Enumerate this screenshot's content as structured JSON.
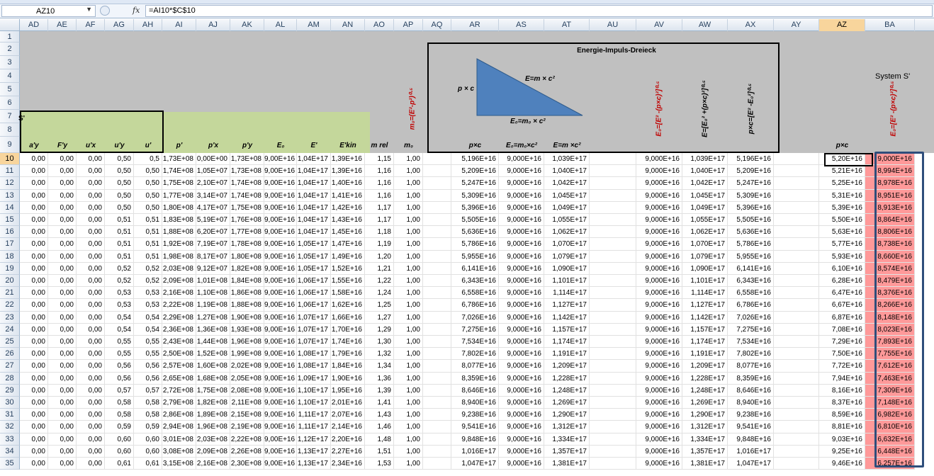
{
  "name_box": "AZ10",
  "fx_label": "fx",
  "formula": "=AI10*$C$10",
  "columns": [
    "AD",
    "AE",
    "AF",
    "AG",
    "AH",
    "AI",
    "AJ",
    "AK",
    "AL",
    "AM",
    "AN",
    "AO",
    "AP",
    "AQ",
    "AR",
    "AS",
    "AT",
    "AU",
    "AV",
    "AW",
    "AX",
    "AY",
    "AZ",
    "BA"
  ],
  "active_column": "AZ",
  "header_rows": [
    "1",
    "2",
    "3",
    "4",
    "5",
    "6",
    "7",
    "8",
    "9"
  ],
  "labels": {
    "s_prime": "S'",
    "diagram_title": "Energie-Impuls-Dreieck",
    "system_s_prime": "System S'",
    "tri_pc": "p × c",
    "tri_emc2": "E=m × c²",
    "tri_e0": "E₀=m₀ × c²",
    "rot_m0": "m₀=(E²-p²)⁰·⁵",
    "rot_e0_av": "E₀=[E² -(p×c)²]⁰·⁵",
    "rot_e_aw": "E=[E₀² +(p×c)²]⁰·⁵",
    "rot_pc_ax": "p×c=[E² -E₀²]⁰·⁵",
    "rot_e0_ba": "E₀=[E² -(p×c)²]⁰·⁵",
    "h_ad": "a'y",
    "h_ae": "F'y",
    "h_af": "u'x",
    "h_ag": "u'y",
    "h_ah": "u'",
    "h_ai": "p'",
    "h_aj": "p'x",
    "h_ak": "p'y",
    "h_al": "E₀",
    "h_am": "E'",
    "h_an": "E'kin",
    "h_ao": "m rel",
    "h_ap": "m₀",
    "h_ar": "p×c",
    "h_as": "E₀=m₀×c²",
    "h_at": "E=m ×c²",
    "h_az": "p×c"
  },
  "rows": [
    {
      "r": "10",
      "v": [
        "0,00",
        "0,00",
        "0,00",
        "0,50",
        "0,5",
        "1,73E+08",
        "0,00E+00",
        "1,73E+08",
        "9,00E+16",
        "1,04E+17",
        "1,39E+16",
        "1,15",
        "1,00",
        "",
        "5,196E+16",
        "9,000E+16",
        "1,039E+17",
        "",
        "9,000E+16",
        "1,039E+17",
        "5,196E+16",
        "",
        "5,20E+16",
        "9,000E+16"
      ]
    },
    {
      "r": "11",
      "v": [
        "0,00",
        "0,00",
        "0,00",
        "0,50",
        "0,50",
        "1,74E+08",
        "1,05E+07",
        "1,73E+08",
        "9,00E+16",
        "1,04E+17",
        "1,39E+16",
        "1,16",
        "1,00",
        "",
        "5,209E+16",
        "9,000E+16",
        "1,040E+17",
        "",
        "9,000E+16",
        "1,040E+17",
        "5,209E+16",
        "",
        "5,21E+16",
        "8,994E+16"
      ]
    },
    {
      "r": "12",
      "v": [
        "0,00",
        "0,00",
        "0,00",
        "0,50",
        "0,50",
        "1,75E+08",
        "2,10E+07",
        "1,74E+08",
        "9,00E+16",
        "1,04E+17",
        "1,40E+16",
        "1,16",
        "1,00",
        "",
        "5,247E+16",
        "9,000E+16",
        "1,042E+17",
        "",
        "9,000E+16",
        "1,042E+17",
        "5,247E+16",
        "",
        "5,25E+16",
        "8,978E+16"
      ]
    },
    {
      "r": "13",
      "v": [
        "0,00",
        "0,00",
        "0,00",
        "0,50",
        "0,50",
        "1,77E+08",
        "3,14E+07",
        "1,74E+08",
        "9,00E+16",
        "1,04E+17",
        "1,41E+16",
        "1,16",
        "1,00",
        "",
        "5,309E+16",
        "9,000E+16",
        "1,045E+17",
        "",
        "9,000E+16",
        "1,045E+17",
        "5,309E+16",
        "",
        "5,31E+16",
        "8,951E+16"
      ]
    },
    {
      "r": "14",
      "v": [
        "0,00",
        "0,00",
        "0,00",
        "0,50",
        "0,50",
        "1,80E+08",
        "4,17E+07",
        "1,75E+08",
        "9,00E+16",
        "1,04E+17",
        "1,42E+16",
        "1,17",
        "1,00",
        "",
        "5,396E+16",
        "9,000E+16",
        "1,049E+17",
        "",
        "9,000E+16",
        "1,049E+17",
        "5,396E+16",
        "",
        "5,39E+16",
        "8,913E+16"
      ]
    },
    {
      "r": "15",
      "v": [
        "0,00",
        "0,00",
        "0,00",
        "0,51",
        "0,51",
        "1,83E+08",
        "5,19E+07",
        "1,76E+08",
        "9,00E+16",
        "1,04E+17",
        "1,43E+16",
        "1,17",
        "1,00",
        "",
        "5,505E+16",
        "9,000E+16",
        "1,055E+17",
        "",
        "9,000E+16",
        "1,055E+17",
        "5,505E+16",
        "",
        "5,50E+16",
        "8,864E+16"
      ]
    },
    {
      "r": "16",
      "v": [
        "0,00",
        "0,00",
        "0,00",
        "0,51",
        "0,51",
        "1,88E+08",
        "6,20E+07",
        "1,77E+08",
        "9,00E+16",
        "1,04E+17",
        "1,45E+16",
        "1,18",
        "1,00",
        "",
        "5,636E+16",
        "9,000E+16",
        "1,062E+17",
        "",
        "9,000E+16",
        "1,062E+17",
        "5,636E+16",
        "",
        "5,63E+16",
        "8,806E+16"
      ]
    },
    {
      "r": "17",
      "v": [
        "0,00",
        "0,00",
        "0,00",
        "0,51",
        "0,51",
        "1,92E+08",
        "7,19E+07",
        "1,78E+08",
        "9,00E+16",
        "1,05E+17",
        "1,47E+16",
        "1,19",
        "1,00",
        "",
        "5,786E+16",
        "9,000E+16",
        "1,070E+17",
        "",
        "9,000E+16",
        "1,070E+17",
        "5,786E+16",
        "",
        "5,77E+16",
        "8,738E+16"
      ]
    },
    {
      "r": "18",
      "v": [
        "0,00",
        "0,00",
        "0,00",
        "0,51",
        "0,51",
        "1,98E+08",
        "8,17E+07",
        "1,80E+08",
        "9,00E+16",
        "1,05E+17",
        "1,49E+16",
        "1,20",
        "1,00",
        "",
        "5,955E+16",
        "9,000E+16",
        "1,079E+17",
        "",
        "9,000E+16",
        "1,079E+17",
        "5,955E+16",
        "",
        "5,93E+16",
        "8,660E+16"
      ]
    },
    {
      "r": "19",
      "v": [
        "0,00",
        "0,00",
        "0,00",
        "0,52",
        "0,52",
        "2,03E+08",
        "9,12E+07",
        "1,82E+08",
        "9,00E+16",
        "1,05E+17",
        "1,52E+16",
        "1,21",
        "1,00",
        "",
        "6,141E+16",
        "9,000E+16",
        "1,090E+17",
        "",
        "9,000E+16",
        "1,090E+17",
        "6,141E+16",
        "",
        "6,10E+16",
        "8,574E+16"
      ]
    },
    {
      "r": "20",
      "v": [
        "0,00",
        "0,00",
        "0,00",
        "0,52",
        "0,52",
        "2,09E+08",
        "1,01E+08",
        "1,84E+08",
        "9,00E+16",
        "1,06E+17",
        "1,55E+16",
        "1,22",
        "1,00",
        "",
        "6,343E+16",
        "9,000E+16",
        "1,101E+17",
        "",
        "9,000E+16",
        "1,101E+17",
        "6,343E+16",
        "",
        "6,28E+16",
        "8,479E+16"
      ]
    },
    {
      "r": "21",
      "v": [
        "0,00",
        "0,00",
        "0,00",
        "0,53",
        "0,53",
        "2,16E+08",
        "1,10E+08",
        "1,86E+08",
        "9,00E+16",
        "1,06E+17",
        "1,58E+16",
        "1,24",
        "1,00",
        "",
        "6,558E+16",
        "9,000E+16",
        "1,114E+17",
        "",
        "9,000E+16",
        "1,114E+17",
        "6,558E+16",
        "",
        "6,47E+16",
        "8,376E+16"
      ]
    },
    {
      "r": "22",
      "v": [
        "0,00",
        "0,00",
        "0,00",
        "0,53",
        "0,53",
        "2,22E+08",
        "1,19E+08",
        "1,88E+08",
        "9,00E+16",
        "1,06E+17",
        "1,62E+16",
        "1,25",
        "1,00",
        "",
        "6,786E+16",
        "9,000E+16",
        "1,127E+17",
        "",
        "9,000E+16",
        "1,127E+17",
        "6,786E+16",
        "",
        "6,67E+16",
        "8,266E+16"
      ]
    },
    {
      "r": "23",
      "v": [
        "0,00",
        "0,00",
        "0,00",
        "0,54",
        "0,54",
        "2,29E+08",
        "1,27E+08",
        "1,90E+08",
        "9,00E+16",
        "1,07E+17",
        "1,66E+16",
        "1,27",
        "1,00",
        "",
        "7,026E+16",
        "9,000E+16",
        "1,142E+17",
        "",
        "9,000E+16",
        "1,142E+17",
        "7,026E+16",
        "",
        "6,87E+16",
        "8,148E+16"
      ]
    },
    {
      "r": "24",
      "v": [
        "0,00",
        "0,00",
        "0,00",
        "0,54",
        "0,54",
        "2,36E+08",
        "1,36E+08",
        "1,93E+08",
        "9,00E+16",
        "1,07E+17",
        "1,70E+16",
        "1,29",
        "1,00",
        "",
        "7,275E+16",
        "9,000E+16",
        "1,157E+17",
        "",
        "9,000E+16",
        "1,157E+17",
        "7,275E+16",
        "",
        "7,08E+16",
        "8,023E+16"
      ]
    },
    {
      "r": "25",
      "v": [
        "0,00",
        "0,00",
        "0,00",
        "0,55",
        "0,55",
        "2,43E+08",
        "1,44E+08",
        "1,96E+08",
        "9,00E+16",
        "1,07E+17",
        "1,74E+16",
        "1,30",
        "1,00",
        "",
        "7,534E+16",
        "9,000E+16",
        "1,174E+17",
        "",
        "9,000E+16",
        "1,174E+17",
        "7,534E+16",
        "",
        "7,29E+16",
        "7,893E+16"
      ]
    },
    {
      "r": "26",
      "v": [
        "0,00",
        "0,00",
        "0,00",
        "0,55",
        "0,55",
        "2,50E+08",
        "1,52E+08",
        "1,99E+08",
        "9,00E+16",
        "1,08E+17",
        "1,79E+16",
        "1,32",
        "1,00",
        "",
        "7,802E+16",
        "9,000E+16",
        "1,191E+17",
        "",
        "9,000E+16",
        "1,191E+17",
        "7,802E+16",
        "",
        "7,50E+16",
        "7,755E+16"
      ]
    },
    {
      "r": "27",
      "v": [
        "0,00",
        "0,00",
        "0,00",
        "0,56",
        "0,56",
        "2,57E+08",
        "1,60E+08",
        "2,02E+08",
        "9,00E+16",
        "1,08E+17",
        "1,84E+16",
        "1,34",
        "1,00",
        "",
        "8,077E+16",
        "9,000E+16",
        "1,209E+17",
        "",
        "9,000E+16",
        "1,209E+17",
        "8,077E+16",
        "",
        "7,72E+16",
        "7,612E+16"
      ]
    },
    {
      "r": "28",
      "v": [
        "0,00",
        "0,00",
        "0,00",
        "0,56",
        "0,56",
        "2,65E+08",
        "1,68E+08",
        "2,05E+08",
        "9,00E+16",
        "1,09E+17",
        "1,90E+16",
        "1,36",
        "1,00",
        "",
        "8,359E+16",
        "9,000E+16",
        "1,228E+17",
        "",
        "9,000E+16",
        "1,228E+17",
        "8,359E+16",
        "",
        "7,94E+16",
        "7,463E+16"
      ]
    },
    {
      "r": "29",
      "v": [
        "0,00",
        "0,00",
        "0,00",
        "0,57",
        "0,57",
        "2,72E+08",
        "1,75E+08",
        "2,08E+08",
        "9,00E+16",
        "1,10E+17",
        "1,95E+16",
        "1,39",
        "1,00",
        "",
        "8,646E+16",
        "9,000E+16",
        "1,248E+17",
        "",
        "9,000E+16",
        "1,248E+17",
        "8,646E+16",
        "",
        "8,16E+16",
        "7,309E+16"
      ]
    },
    {
      "r": "30",
      "v": [
        "0,00",
        "0,00",
        "0,00",
        "0,58",
        "0,58",
        "2,79E+08",
        "1,82E+08",
        "2,11E+08",
        "9,00E+16",
        "1,10E+17",
        "2,01E+16",
        "1,41",
        "1,00",
        "",
        "8,940E+16",
        "9,000E+16",
        "1,269E+17",
        "",
        "9,000E+16",
        "1,269E+17",
        "8,940E+16",
        "",
        "8,37E+16",
        "7,148E+16"
      ]
    },
    {
      "r": "31",
      "v": [
        "0,00",
        "0,00",
        "0,00",
        "0,58",
        "0,58",
        "2,86E+08",
        "1,89E+08",
        "2,15E+08",
        "9,00E+16",
        "1,11E+17",
        "2,07E+16",
        "1,43",
        "1,00",
        "",
        "9,238E+16",
        "9,000E+16",
        "1,290E+17",
        "",
        "9,000E+16",
        "1,290E+17",
        "9,238E+16",
        "",
        "8,59E+16",
        "6,982E+16"
      ]
    },
    {
      "r": "32",
      "v": [
        "0,00",
        "0,00",
        "0,00",
        "0,59",
        "0,59",
        "2,94E+08",
        "1,96E+08",
        "2,19E+08",
        "9,00E+16",
        "1,11E+17",
        "2,14E+16",
        "1,46",
        "1,00",
        "",
        "9,541E+16",
        "9,000E+16",
        "1,312E+17",
        "",
        "9,000E+16",
        "1,312E+17",
        "9,541E+16",
        "",
        "8,81E+16",
        "6,810E+16"
      ]
    },
    {
      "r": "33",
      "v": [
        "0,00",
        "0,00",
        "0,00",
        "0,60",
        "0,60",
        "3,01E+08",
        "2,03E+08",
        "2,22E+08",
        "9,00E+16",
        "1,12E+17",
        "2,20E+16",
        "1,48",
        "1,00",
        "",
        "9,848E+16",
        "9,000E+16",
        "1,334E+17",
        "",
        "9,000E+16",
        "1,334E+17",
        "9,848E+16",
        "",
        "9,03E+16",
        "6,632E+16"
      ]
    },
    {
      "r": "34",
      "v": [
        "0,00",
        "0,00",
        "0,00",
        "0,60",
        "0,60",
        "3,08E+08",
        "2,09E+08",
        "2,26E+08",
        "9,00E+16",
        "1,13E+17",
        "2,27E+16",
        "1,51",
        "1,00",
        "",
        "1,016E+17",
        "9,000E+16",
        "1,357E+17",
        "",
        "9,000E+16",
        "1,357E+17",
        "1,016E+17",
        "",
        "9,25E+16",
        "6,448E+16"
      ]
    },
    {
      "r": "35",
      "v": [
        "0,00",
        "0,00",
        "0,00",
        "0,61",
        "0,61",
        "3,15E+08",
        "2,16E+08",
        "2,30E+08",
        "9,00E+16",
        "1,13E+17",
        "2,34E+16",
        "1,53",
        "1,00",
        "",
        "1,047E+17",
        "9,000E+16",
        "1,381E+17",
        "",
        "9,000E+16",
        "1,381E+17",
        "1,047E+17",
        "",
        "9,46E+16",
        "6,257E+16"
      ]
    }
  ],
  "colors": {
    "green_fill": "#c4d79b",
    "grey_fill": "#c0c0c0",
    "triangle": "#4f81bd",
    "red_text": "#c00000",
    "pink_fill": "#ff9999",
    "selection_box": "#2f4e7b",
    "active_header": "#f8d59c"
  }
}
